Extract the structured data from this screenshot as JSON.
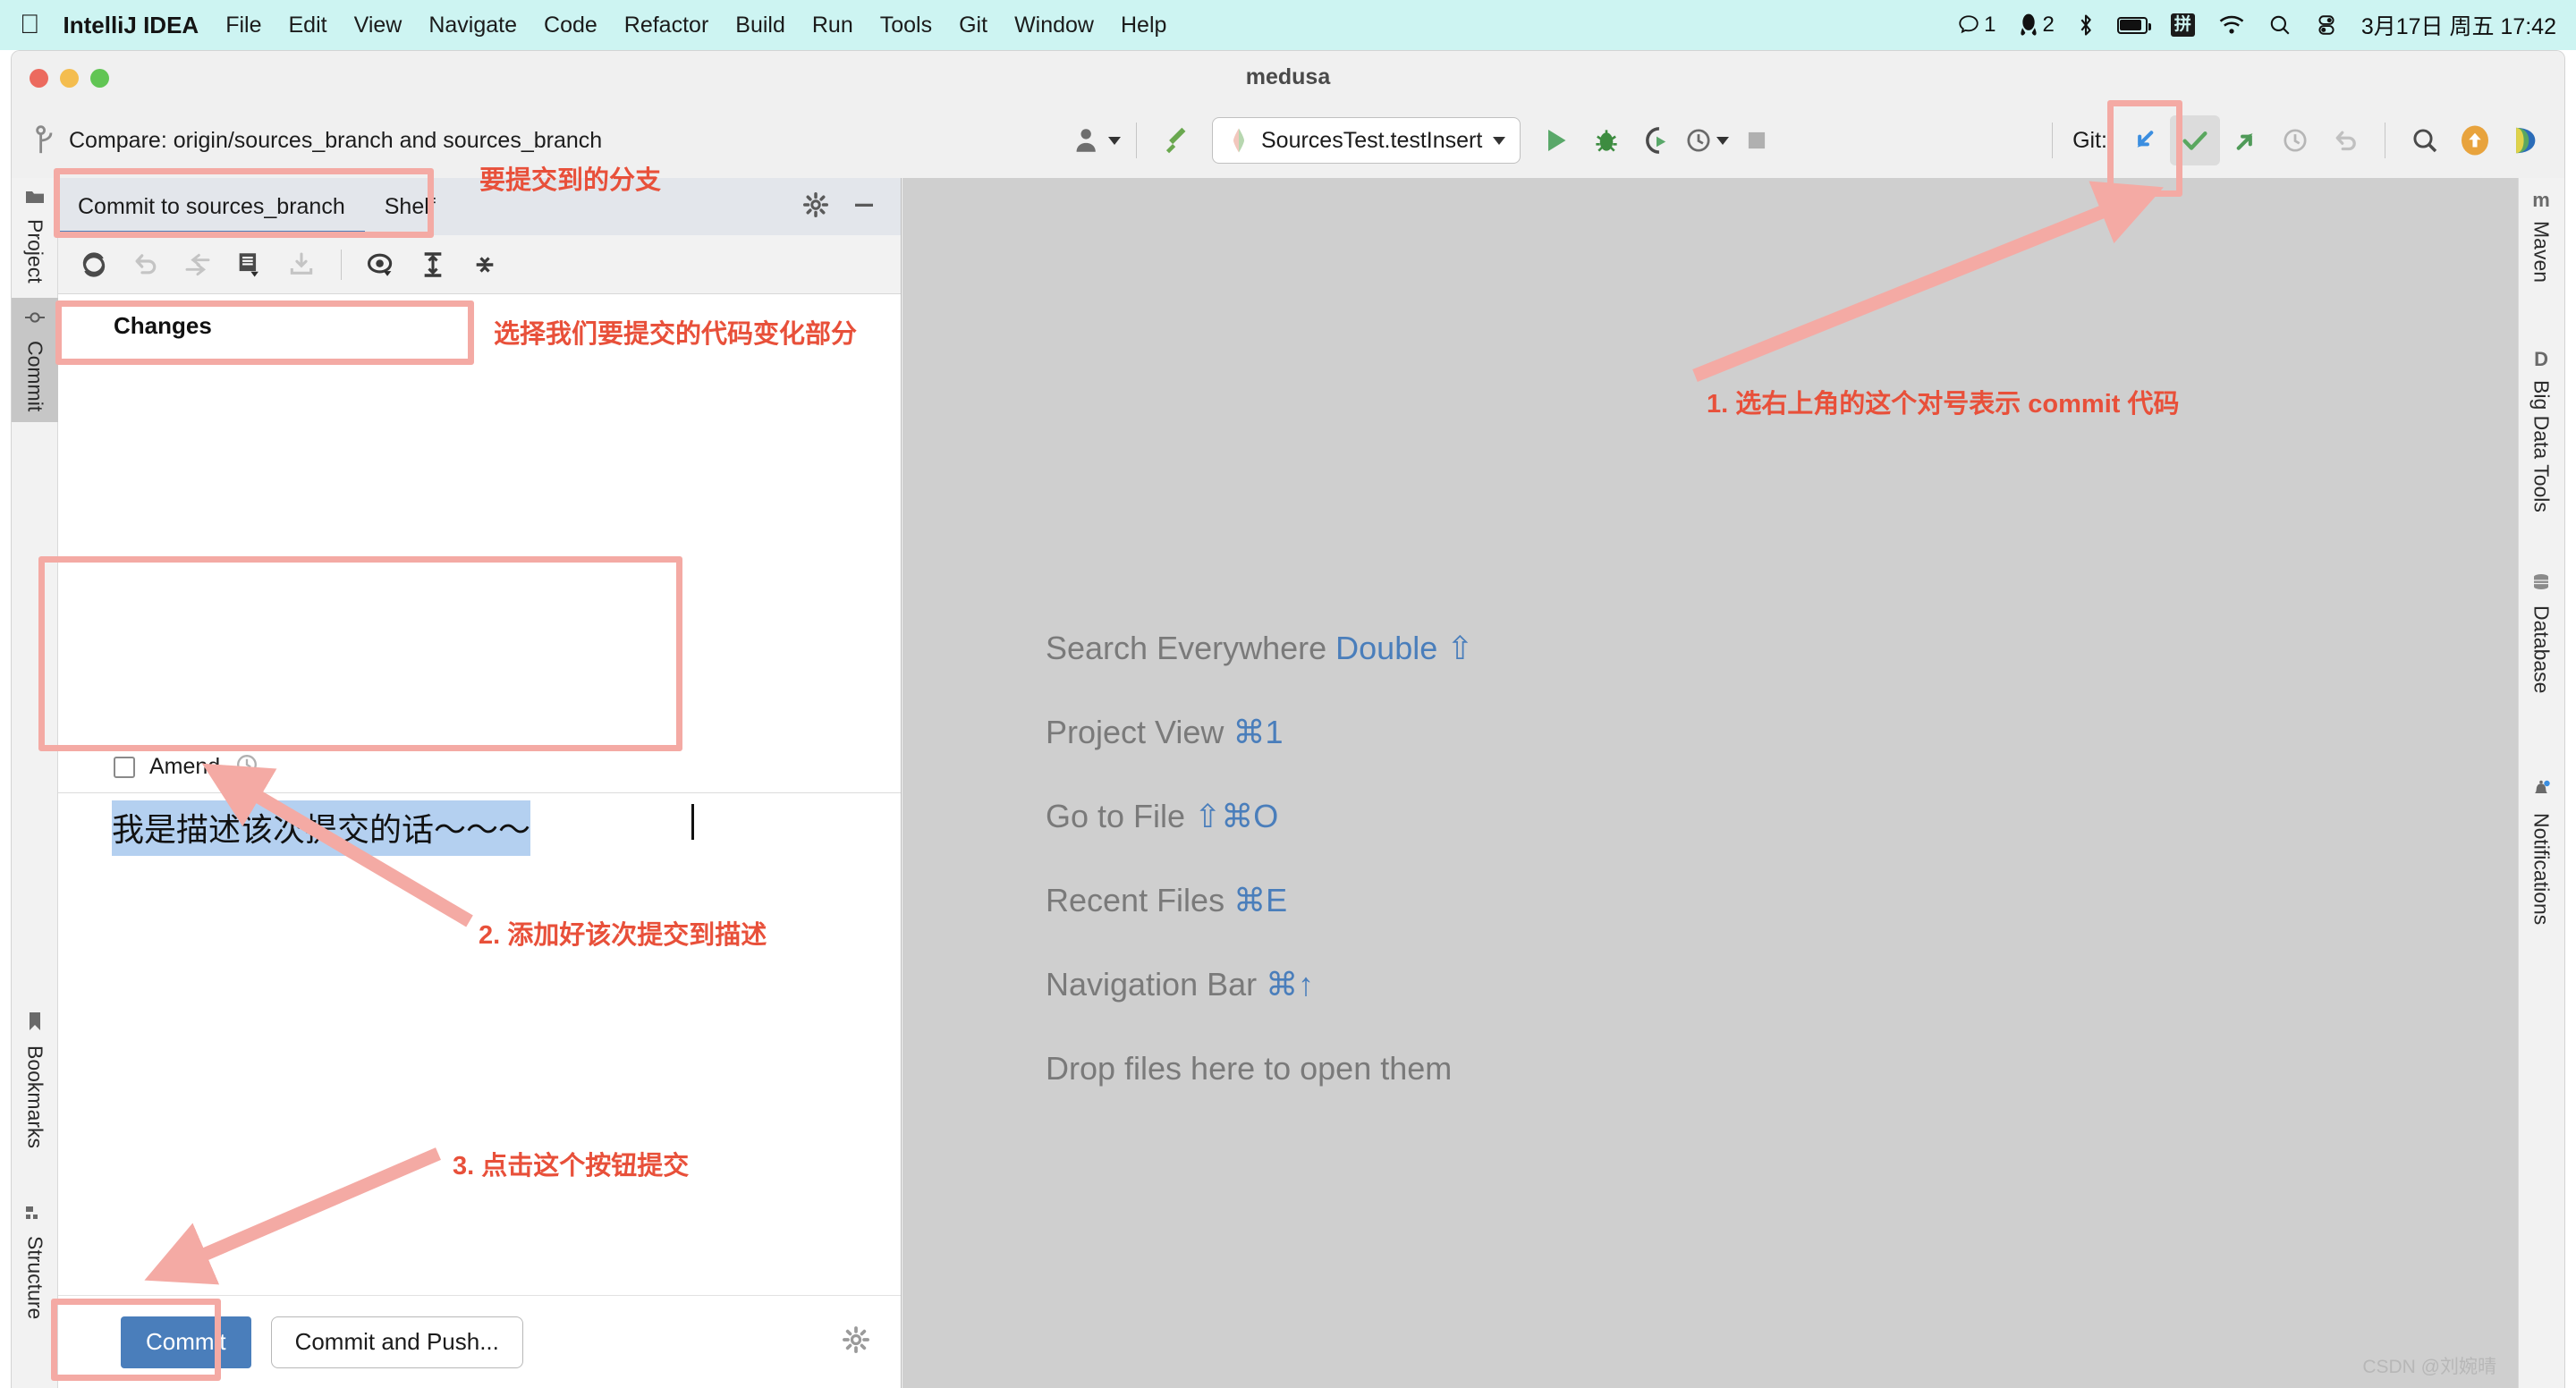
{
  "macbar": {
    "apple_icon": "apple-logo-icon",
    "app_name": "IntelliJ IDEA",
    "menus": [
      "File",
      "Edit",
      "View",
      "Navigate",
      "Code",
      "Refactor",
      "Build",
      "Run",
      "Tools",
      "Git",
      "Window",
      "Help"
    ],
    "status": {
      "messages_icon": "chat-bubble-icon",
      "messages_count": "1",
      "qq_icon": "penguin-icon",
      "qq_count": "2",
      "bluetooth_icon": "bluetooth-icon",
      "battery_icon": "battery-icon",
      "input_method": "拼",
      "wifi_icon": "wifi-icon",
      "search_icon": "spotlight-search-icon",
      "control_center_icon": "control-center-icon",
      "clock": "3月17日 周五  17:42"
    }
  },
  "window": {
    "title": "medusa",
    "traffic_lights": [
      "close-button",
      "minimize-button",
      "zoom-button"
    ]
  },
  "toolbar": {
    "branch_icon": "git-branch-icon",
    "branch_text": "Compare: origin/sources_branch and sources_branch",
    "vcs_user_icon": "user-avatar-icon",
    "build_icon": "hammer-build-icon",
    "run_config": {
      "icon": "run-config-icon",
      "name": "SourcesTest.testInsert",
      "dropdown_icon": "chevron-down-icon"
    },
    "run_icon": "run-play-icon",
    "debug_icon": "debug-bug-icon",
    "coverage_icon": "run-with-coverage-icon",
    "profiler_icon": "profiler-clock-icon",
    "stop_icon": "stop-square-icon",
    "git_label": "Git:",
    "git_update_icon": "update-project-arrow-icon",
    "git_commit_icon": "commit-checkmark-icon",
    "git_push_icon": "push-arrow-icon",
    "git_history_icon": "history-clock-icon",
    "git_rollback_icon": "rollback-undo-icon",
    "search_icon": "search-magnifier-icon",
    "updates_icon": "update-orange-arrow-icon",
    "ide_icon": "ide-feature-icon"
  },
  "left_strip": {
    "tabs": [
      {
        "label": "Project",
        "icon": "project-folder-icon",
        "active": false
      },
      {
        "label": "Commit",
        "icon": "commit-icon",
        "active": true
      },
      {
        "label": "Bookmarks",
        "icon": "bookmark-icon",
        "active": false
      },
      {
        "label": "Structure",
        "icon": "structure-icon",
        "active": false
      }
    ]
  },
  "right_strip": {
    "tabs": [
      {
        "label": "Maven",
        "icon": "maven-m-icon"
      },
      {
        "label": "Big Data Tools",
        "icon": "big-data-d-icon"
      },
      {
        "label": "Database",
        "icon": "database-cylinder-icon"
      },
      {
        "label": "Notifications",
        "icon": "notifications-bell-icon"
      }
    ]
  },
  "commit_panel": {
    "tabs": [
      {
        "label": "Commit to sources_branch",
        "active": true
      },
      {
        "label": "Shelf",
        "active": false
      }
    ],
    "header_actions": [
      {
        "icon": "gear-settings-icon"
      },
      {
        "icon": "minimize-dash-icon"
      }
    ],
    "toolbar_icons": [
      {
        "icon": "refresh-changes-icon",
        "enabled": true
      },
      {
        "icon": "rollback-arrow-icon",
        "enabled": false
      },
      {
        "icon": "move-to-another-changelist-icon",
        "enabled": false
      },
      {
        "icon": "show-diff-with-dropdown-icon",
        "enabled": true
      },
      {
        "icon": "shelve-download-icon",
        "enabled": false
      },
      {
        "icon": "group-by-eye-icon",
        "enabled": true
      },
      {
        "icon": "expand-all-icon",
        "enabled": true
      },
      {
        "icon": "collapse-all-icon",
        "enabled": true
      }
    ],
    "changes_node_label": "Changes",
    "amend": {
      "label": "Amend",
      "checked": false,
      "history_icon": "history-clock-icon"
    },
    "commit_message": "我是描述该次提交的话～～～",
    "buttons": {
      "commit": "Commit",
      "commit_and_push": "Commit and Push...",
      "settings_icon": "gear-settings-icon"
    }
  },
  "editor": {
    "shortcuts": [
      {
        "action": "Search Everywhere",
        "keys": "Double ⇧"
      },
      {
        "action": "Project View",
        "keys": "⌘1"
      },
      {
        "action": "Go to File",
        "keys": "⇧⌘O"
      },
      {
        "action": "Recent Files",
        "keys": "⌘E"
      },
      {
        "action": "Navigation Bar",
        "keys": "⌘↑"
      }
    ],
    "drop_hint": "Drop files here to open them"
  },
  "annotations": {
    "branch_note": "要提交到的分支",
    "changes_note": "选择我们要提交的代码变化部分",
    "step1": "1. 选右上角的这个对号表示 commit 代码",
    "step2": "2. 添加好该次提交到描述",
    "step3": "3. 点击这个按钮提交"
  },
  "watermark": "CSDN @刘婉晴",
  "colors": {
    "menubar_bg": "#cdf4f2",
    "accent_blue": "#4a7ebb",
    "annotation_red": "#e8503a",
    "annotation_pink": "#f4aaa4",
    "editor_bg": "#cfcfcf"
  }
}
